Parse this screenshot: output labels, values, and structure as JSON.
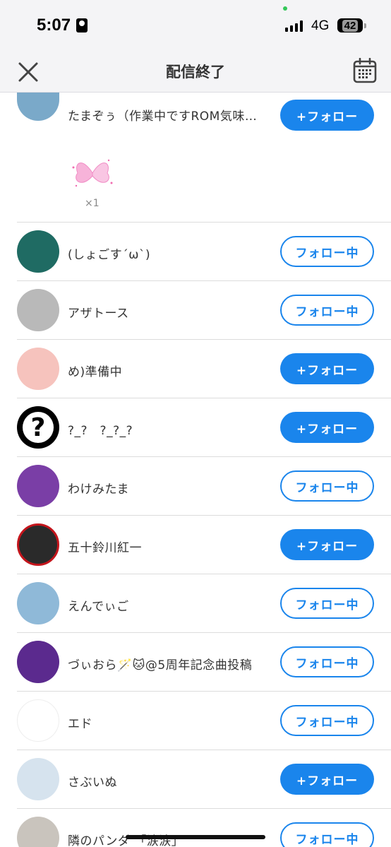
{
  "status": {
    "time": "5:07",
    "network": "4G",
    "battery": "42"
  },
  "header": {
    "title": "配信終了",
    "close_icon": "close-icon",
    "calendar_icon": "calendar-icon"
  },
  "labels": {
    "follow": "+フォロー",
    "following": "フォロー中"
  },
  "gift": {
    "icon": "butterfly-icon",
    "count": "×1"
  },
  "users": [
    {
      "name": "たまぞぅ（作業中ですROM気味…",
      "state": "follow",
      "avatar_color": "#7aa9c9"
    },
    {
      "name": "(しょごす´ω`)",
      "state": "following",
      "avatar_color": "#1f6b63"
    },
    {
      "name": "アザトース",
      "state": "following",
      "avatar_color": "#b9b9b9"
    },
    {
      "name": "め)準備中",
      "state": "follow",
      "avatar_color": "#f6c3bd"
    },
    {
      "name": "?_?　?_?_?",
      "state": "follow",
      "avatar_color": "#000000"
    },
    {
      "name": "わけみたま",
      "state": "following",
      "avatar_color": "#7a3ea6"
    },
    {
      "name": "五十鈴川紅一",
      "state": "follow",
      "avatar_color": "#c4151c"
    },
    {
      "name": "えんでぃご",
      "state": "following",
      "avatar_color": "#8fb9d8"
    },
    {
      "name": "づぃおら🪄🐱@5周年記念曲投稿",
      "state": "following",
      "avatar_color": "#5b2a8e"
    },
    {
      "name": "エド",
      "state": "following",
      "avatar_color": "#ffffff"
    },
    {
      "name": "さぶいぬ",
      "state": "follow",
      "avatar_color": "#d6e3ee"
    },
    {
      "name": "隣のパンダ 「涙涙」",
      "state": "following",
      "avatar_color": "#c9c4bd"
    }
  ],
  "colors": {
    "accent": "#1a85ec",
    "header_bg": "#f4f4f6"
  }
}
